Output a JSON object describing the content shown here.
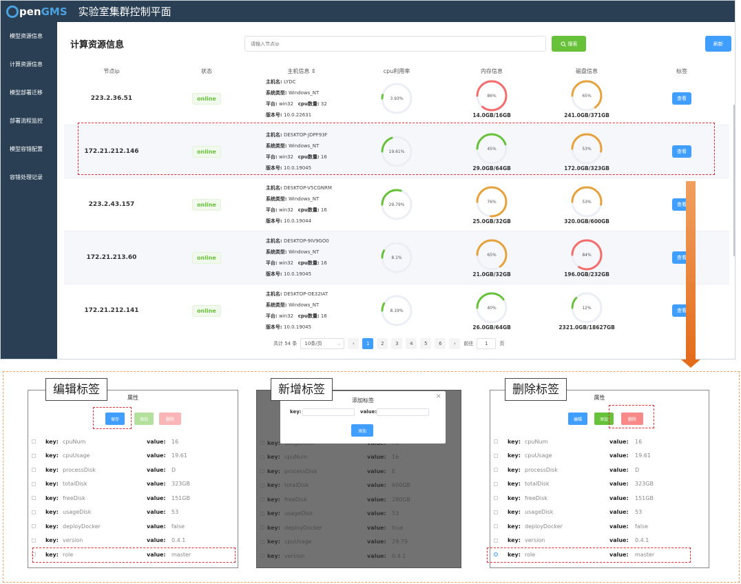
{
  "app": {
    "logo_prefix": "O",
    "logo_mid": "pen",
    "logo_suffix": "GMS",
    "title": "实验室集群控制平面"
  },
  "sidebar": {
    "items": [
      {
        "label": "模型资源信息"
      },
      {
        "label": "计算资源信息"
      },
      {
        "label": "模型部署迁移"
      },
      {
        "label": "部署流程监控"
      },
      {
        "label": "模型容错配置"
      },
      {
        "label": "容错处理记录"
      }
    ]
  },
  "main": {
    "title": "计算资源信息",
    "search_placeholder": "请输入节点ip",
    "search_label": "搜索",
    "refresh_label": "刷新",
    "columns": [
      "节点ip",
      "状态",
      "主机信息 ⇕",
      "cpu利用率",
      "内存信息",
      "磁盘信息",
      "标签"
    ],
    "host_labels": {
      "hostname": "主机名:",
      "systype": "系统类型:",
      "platform": "平台:",
      "cpunum": "cpu数量:",
      "version": "版本号:"
    },
    "view_label": "查看",
    "colors": {
      "green": "#67c23a",
      "orange": "#e6a23c",
      "red": "#f56c6c",
      "blue": "#409eff",
      "sidebar": "#2a3f54"
    },
    "rows": [
      {
        "ip": "223.2.36.51",
        "status": "online",
        "hostname": "LYDC",
        "systype": "Windows_NT",
        "platform": "win32",
        "cpunum": "32",
        "version": "10.0.22631",
        "cpu": 3.93,
        "cpu_text": "3.93%",
        "mem": 86,
        "mem_text": "86%",
        "mem_label": "14.0GB/16GB",
        "disk": 65,
        "disk_text": "65%",
        "disk_label": "241.0GB/371GB"
      },
      {
        "ip": "172.21.212.146",
        "status": "online",
        "hostname": "DESKTOP-JDPF93F",
        "systype": "Windows_NT",
        "platform": "win32",
        "cpunum": "16",
        "version": "10.0.19045",
        "cpu": 19.61,
        "cpu_text": "19.61%",
        "mem": 45,
        "mem_text": "45%",
        "mem_label": "29.0GB/64GB",
        "disk": 53,
        "disk_text": "53%",
        "disk_label": "172.0GB/323GB"
      },
      {
        "ip": "223.2.43.157",
        "status": "online",
        "hostname": "DESKTOP-V5CGNRM",
        "systype": "Windows_NT",
        "platform": "win32",
        "cpunum": "16",
        "version": "10.0.19044",
        "cpu": 29.79,
        "cpu_text": "29.79%",
        "mem": 76,
        "mem_text": "76%",
        "mem_label": "25.0GB/32GB",
        "disk": 53,
        "disk_text": "53%",
        "disk_label": "320.0GB/600GB"
      },
      {
        "ip": "172.21.213.60",
        "status": "online",
        "hostname": "DESKTOP-9IV9GO0",
        "systype": "Windows_NT",
        "platform": "win32",
        "cpunum": "16",
        "version": "10.0.19045",
        "cpu": 8.1,
        "cpu_text": "8.1%",
        "mem": 65,
        "mem_text": "65%",
        "mem_label": "21.0GB/32GB",
        "disk": 84,
        "disk_text": "84%",
        "disk_label": "196.0GB/232GB"
      },
      {
        "ip": "172.21.212.141",
        "status": "online",
        "hostname": "DESKTOP-OE32IAT",
        "systype": "Windows_NT",
        "platform": "win32",
        "cpunum": "16",
        "version": "10.0.19045",
        "cpu": 8.19,
        "cpu_text": "8.19%",
        "mem": 40,
        "mem_text": "40%",
        "mem_label": "26.0GB/64GB",
        "disk": 12,
        "disk_text": "12%",
        "disk_label": "2321.0GB/18627GB"
      }
    ],
    "pagination": {
      "total": "共计 54 条",
      "page_size": "10条/页",
      "pages": [
        "1",
        "2",
        "3",
        "4",
        "5",
        "6"
      ],
      "current": "1",
      "goto_label": "前往",
      "goto_value": "1",
      "page_suffix": "页",
      "prev": "‹",
      "next": "›"
    }
  },
  "panels": {
    "edit": {
      "callout": "编辑标签",
      "title": "属性",
      "buttons": {
        "save": "保存",
        "add": "添加",
        "delete": "删除"
      },
      "rows": [
        {
          "key": "cpuNum",
          "value": "16"
        },
        {
          "key": "cpuUsage",
          "value": "19.61"
        },
        {
          "key": "processDisk",
          "value": "D"
        },
        {
          "key": "totalDisk",
          "value": "323GB"
        },
        {
          "key": "freeDisk",
          "value": "151GB"
        },
        {
          "key": "usageDisk",
          "value": "53"
        },
        {
          "key": "deployDocker",
          "value": "false"
        },
        {
          "key": "version",
          "value": "0.4.1"
        },
        {
          "key": "role",
          "value": "master"
        }
      ]
    },
    "add": {
      "callout": "新增标签",
      "dialog_title": "添加标签",
      "close": "×",
      "key_label": "key:",
      "value_label": "value:",
      "confirm": "添加",
      "rows": [
        {
          "key": "usageMem",
          "value": "76"
        },
        {
          "key": "cpuNum",
          "value": "16"
        },
        {
          "key": "processDisk",
          "value": "E"
        },
        {
          "key": "totalDisk",
          "value": "600GB"
        },
        {
          "key": "freeDisk",
          "value": "280GB"
        },
        {
          "key": "usageDisk",
          "value": "53"
        },
        {
          "key": "deployDocker",
          "value": "true"
        },
        {
          "key": "cpuUsage",
          "value": "29.79"
        },
        {
          "key": "version",
          "value": "0.4.1"
        }
      ]
    },
    "delete": {
      "callout": "删除标签",
      "title": "属性",
      "buttons": {
        "edit": "编辑",
        "add": "添加",
        "delete": "删除"
      },
      "rows": [
        {
          "key": "cpuNum",
          "value": "16"
        },
        {
          "key": "cpuUsage",
          "value": "19.61"
        },
        {
          "key": "processDisk",
          "value": "D"
        },
        {
          "key": "totalDisk",
          "value": "323GB"
        },
        {
          "key": "freeDisk",
          "value": "151GB"
        },
        {
          "key": "usageDisk",
          "value": "53"
        },
        {
          "key": "deployDocker",
          "value": "false"
        },
        {
          "key": "version",
          "value": "0.4.1"
        },
        {
          "key": "role",
          "value": "master"
        }
      ]
    },
    "key_label": "key:",
    "value_label": "value:"
  }
}
